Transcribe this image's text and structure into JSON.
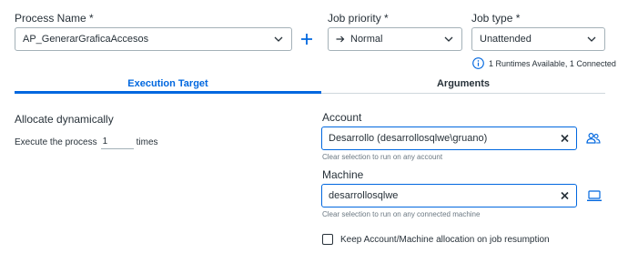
{
  "process": {
    "label": "Process Name *",
    "value": "AP_GenerarGraficaAccesos",
    "add_icon": "plus-icon"
  },
  "job_priority": {
    "label": "Job priority *",
    "value": "Normal",
    "value_icon": "arrow-right-icon"
  },
  "job_type": {
    "label": "Job type *",
    "value": "Unattended",
    "info_text": "1 Runtimes Available, 1 Connected"
  },
  "tabs": [
    {
      "label": "Execution Target",
      "active": true
    },
    {
      "label": "Arguments",
      "active": false
    }
  ],
  "execution": {
    "title": "Allocate dynamically",
    "prefix": "Execute the process",
    "count": "1",
    "suffix": "times"
  },
  "account": {
    "label": "Account",
    "value": "Desarrollo (desarrollosqlwe\\gruano)",
    "helper": "Clear selection to run on any account",
    "side_icon": "users-icon"
  },
  "machine": {
    "label": "Machine",
    "value": "desarrollosqlwe",
    "helper": "Clear selection to run on any connected machine",
    "side_icon": "laptop-icon"
  },
  "keep_allocation": {
    "label": "Keep Account/Machine allocation on job resumption",
    "checked": false
  },
  "colors": {
    "accent": "#0067df",
    "text": "#273139",
    "border": "#a4b1b8",
    "helper": "#6b7882"
  }
}
